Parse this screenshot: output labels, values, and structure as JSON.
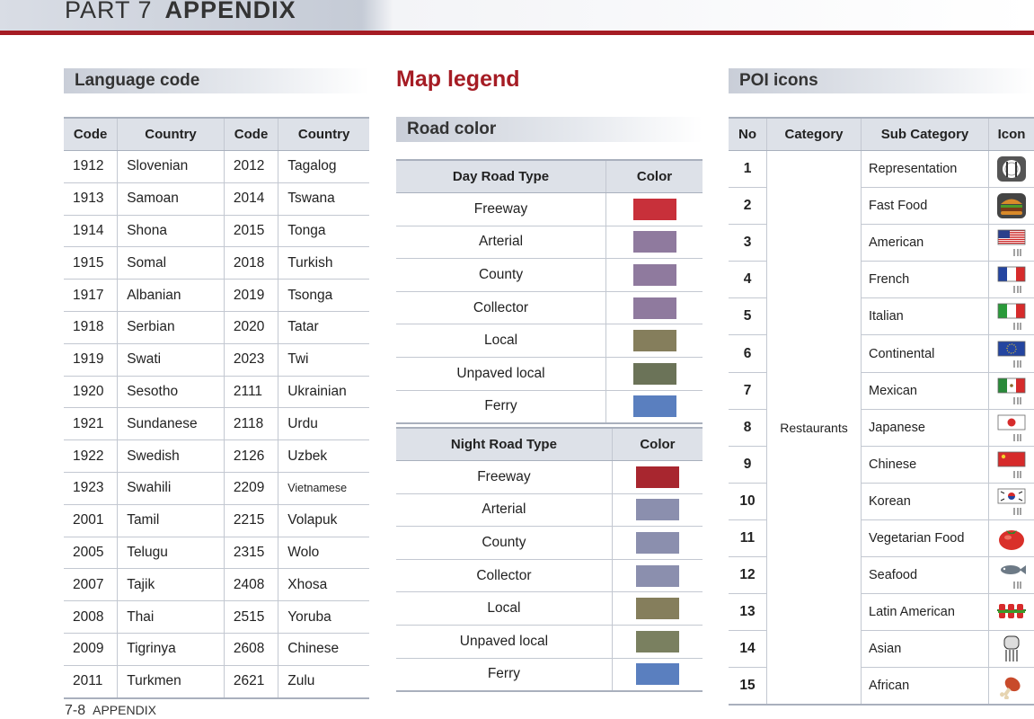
{
  "header": {
    "part": "PART 7",
    "title": "APPENDIX"
  },
  "footer": {
    "page": "7-8",
    "label": "APPENDIX"
  },
  "language": {
    "title": "Language code",
    "headers": [
      "Code",
      "Country",
      "Code",
      "Country"
    ],
    "rows": [
      [
        "1912",
        "Slovenian",
        "2012",
        "Tagalog"
      ],
      [
        "1913",
        "Samoan",
        "2014",
        "Tswana"
      ],
      [
        "1914",
        "Shona",
        "2015",
        "Tonga"
      ],
      [
        "1915",
        "Somal",
        "2018",
        "Turkish"
      ],
      [
        "1917",
        "Albanian",
        "2019",
        "Tsonga"
      ],
      [
        "1918",
        "Serbian",
        "2020",
        "Tatar"
      ],
      [
        "1919",
        "Swati",
        "2023",
        "Twi"
      ],
      [
        "1920",
        "Sesotho",
        "2111",
        "Ukrainian"
      ],
      [
        "1921",
        "Sundanese",
        "2118",
        "Urdu"
      ],
      [
        "1922",
        "Swedish",
        "2126",
        "Uzbek"
      ],
      [
        "1923",
        "Swahili",
        "2209",
        "Vietnamese"
      ],
      [
        "2001",
        "Tamil",
        "2215",
        "Volapuk"
      ],
      [
        "2005",
        "Telugu",
        "2315",
        "Wolo"
      ],
      [
        "2007",
        "Tajik",
        "2408",
        "Xhosa"
      ],
      [
        "2008",
        "Thai",
        "2515",
        "Yoruba"
      ],
      [
        "2009",
        "Tigrinya",
        "2608",
        "Chinese"
      ],
      [
        "2011",
        "Turkmen",
        "2621",
        "Zulu"
      ]
    ]
  },
  "map_legend": {
    "title": "Map legend",
    "road_color_title": "Road color",
    "day": {
      "headers": [
        "Day Road Type",
        "Color"
      ],
      "rows": [
        {
          "name": "Freeway",
          "color": "#c8303a"
        },
        {
          "name": "Arterial",
          "color": "#8f7a9e"
        },
        {
          "name": "County",
          "color": "#8f7a9e"
        },
        {
          "name": "Collector",
          "color": "#8f7a9e"
        },
        {
          "name": "Local",
          "color": "#857e5c"
        },
        {
          "name": "Unpaved local",
          "color": "#6b7358"
        },
        {
          "name": "Ferry",
          "color": "#5a7fbf"
        }
      ]
    },
    "night": {
      "headers": [
        "Night Road Type",
        "Color"
      ],
      "rows": [
        {
          "name": "Freeway",
          "color": "#a8262f"
        },
        {
          "name": "Arterial",
          "color": "#8b8fae"
        },
        {
          "name": "County",
          "color": "#8b8fae"
        },
        {
          "name": "Collector",
          "color": "#8b8fae"
        },
        {
          "name": "Local",
          "color": "#857e5c"
        },
        {
          "name": "Unpaved local",
          "color": "#7a8060"
        },
        {
          "name": "Ferry",
          "color": "#5a7fbf"
        }
      ]
    }
  },
  "poi": {
    "title": "POI icons",
    "headers": [
      "No",
      "Category",
      "Sub Category",
      "Icon"
    ],
    "category": "Restaurants",
    "rows": [
      {
        "no": "1",
        "sub": "Representation",
        "icon": "cutlery-icon"
      },
      {
        "no": "2",
        "sub": "Fast Food",
        "icon": "hamburger-icon"
      },
      {
        "no": "3",
        "sub": "American",
        "icon": "us-flag-icon"
      },
      {
        "no": "4",
        "sub": "French",
        "icon": "french-flag-icon"
      },
      {
        "no": "5",
        "sub": "Italian",
        "icon": "italian-flag-icon"
      },
      {
        "no": "6",
        "sub": "Continental",
        "icon": "eu-flag-icon"
      },
      {
        "no": "7",
        "sub": "Mexican",
        "icon": "mexican-flag-icon"
      },
      {
        "no": "8",
        "sub": "Japanese",
        "icon": "japanese-flag-icon"
      },
      {
        "no": "9",
        "sub": "Chinese",
        "icon": "chinese-flag-icon"
      },
      {
        "no": "10",
        "sub": "Korean",
        "icon": "korean-flag-icon"
      },
      {
        "no": "11",
        "sub": "Vegetarian Food",
        "icon": "tomato-icon"
      },
      {
        "no": "12",
        "sub": "Seafood",
        "icon": "fish-icon"
      },
      {
        "no": "13",
        "sub": "Latin American",
        "icon": "skewer-icon"
      },
      {
        "no": "14",
        "sub": "Asian",
        "icon": "rice-bowl-icon"
      },
      {
        "no": "15",
        "sub": "African",
        "icon": "meat-icon"
      }
    ]
  }
}
